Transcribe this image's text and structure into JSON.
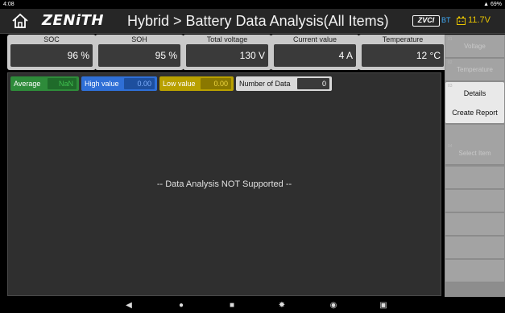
{
  "statusbar": {
    "time": "4:08",
    "system": "69%"
  },
  "header": {
    "logo": "ZENiTH",
    "title": "Hybrid > Battery Data Analysis(All Items)",
    "vci": "ZVCI",
    "bt": "BT",
    "voltage": "11.7V"
  },
  "gauges": [
    {
      "label": "SOC",
      "value": "96 %"
    },
    {
      "label": "SOH",
      "value": "95 %"
    },
    {
      "label": "Total voltage",
      "value": "130 V"
    },
    {
      "label": "Current value",
      "value": "4 A"
    },
    {
      "label": "Temperature",
      "value": "12 °C"
    }
  ],
  "stats": {
    "average": {
      "label": "Average",
      "value": "NaN",
      "color": "#2e8b3a"
    },
    "high": {
      "label": "High value",
      "value": "0.00",
      "color": "#2f6fd6"
    },
    "low": {
      "label": "Low value",
      "value": "0.00",
      "color": "#b8a000"
    },
    "count": {
      "label": "Number of Data",
      "value": "0",
      "color": "#d9d9d9"
    }
  },
  "message": "-- Data Analysis NOT Supported --",
  "sidebar": {
    "items": [
      {
        "label": "Voltage",
        "index": "01"
      },
      {
        "label": "Temperature",
        "index": "02"
      },
      {
        "label": "Details",
        "index": "03"
      },
      {
        "label": "Create Report",
        "index": ""
      },
      {
        "label": "",
        "index": ""
      },
      {
        "label": "Select Item",
        "index": "04"
      },
      {
        "label": "",
        "index": ""
      },
      {
        "label": "",
        "index": ""
      },
      {
        "label": "",
        "index": ""
      },
      {
        "label": "",
        "index": ""
      },
      {
        "label": "",
        "index": ""
      }
    ]
  }
}
